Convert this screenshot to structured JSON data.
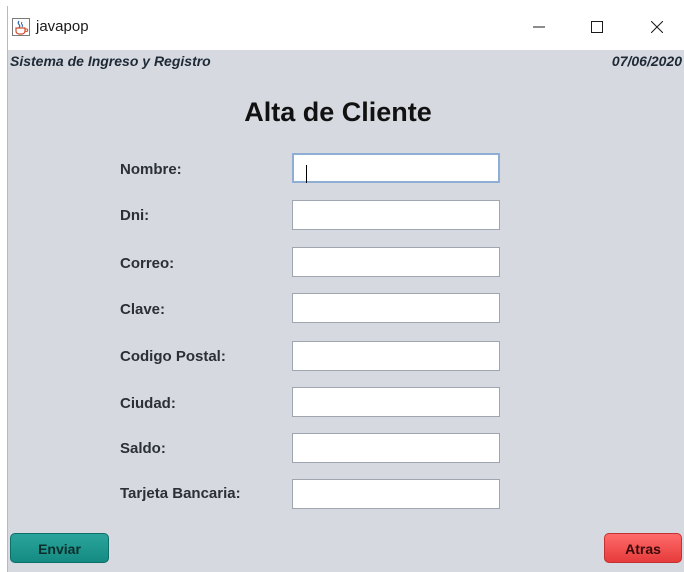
{
  "window": {
    "title": "javapop",
    "icon": "java-cup-icon",
    "controls": [
      "minimize-icon",
      "maximize-icon",
      "close-icon"
    ]
  },
  "header": {
    "system_name": "Sistema de Ingreso y Registro",
    "date": "07/06/2020"
  },
  "form": {
    "title": "Alta de Cliente",
    "fields": [
      {
        "label": "Nombre:",
        "value": ""
      },
      {
        "label": "Dni:",
        "value": ""
      },
      {
        "label": "Correo:",
        "value": ""
      },
      {
        "label": "Clave:",
        "value": ""
      },
      {
        "label": "Codigo Postal:",
        "value": ""
      },
      {
        "label": "Ciudad:",
        "value": ""
      },
      {
        "label": "Saldo:",
        "value": ""
      },
      {
        "label": "Tarjeta Bancaria:",
        "value": ""
      }
    ]
  },
  "buttons": {
    "submit_label": "Enviar",
    "back_label": "Atras"
  },
  "colors": {
    "background": "#d6d9df",
    "submit": "#1a968d",
    "back": "#f24d4d"
  }
}
